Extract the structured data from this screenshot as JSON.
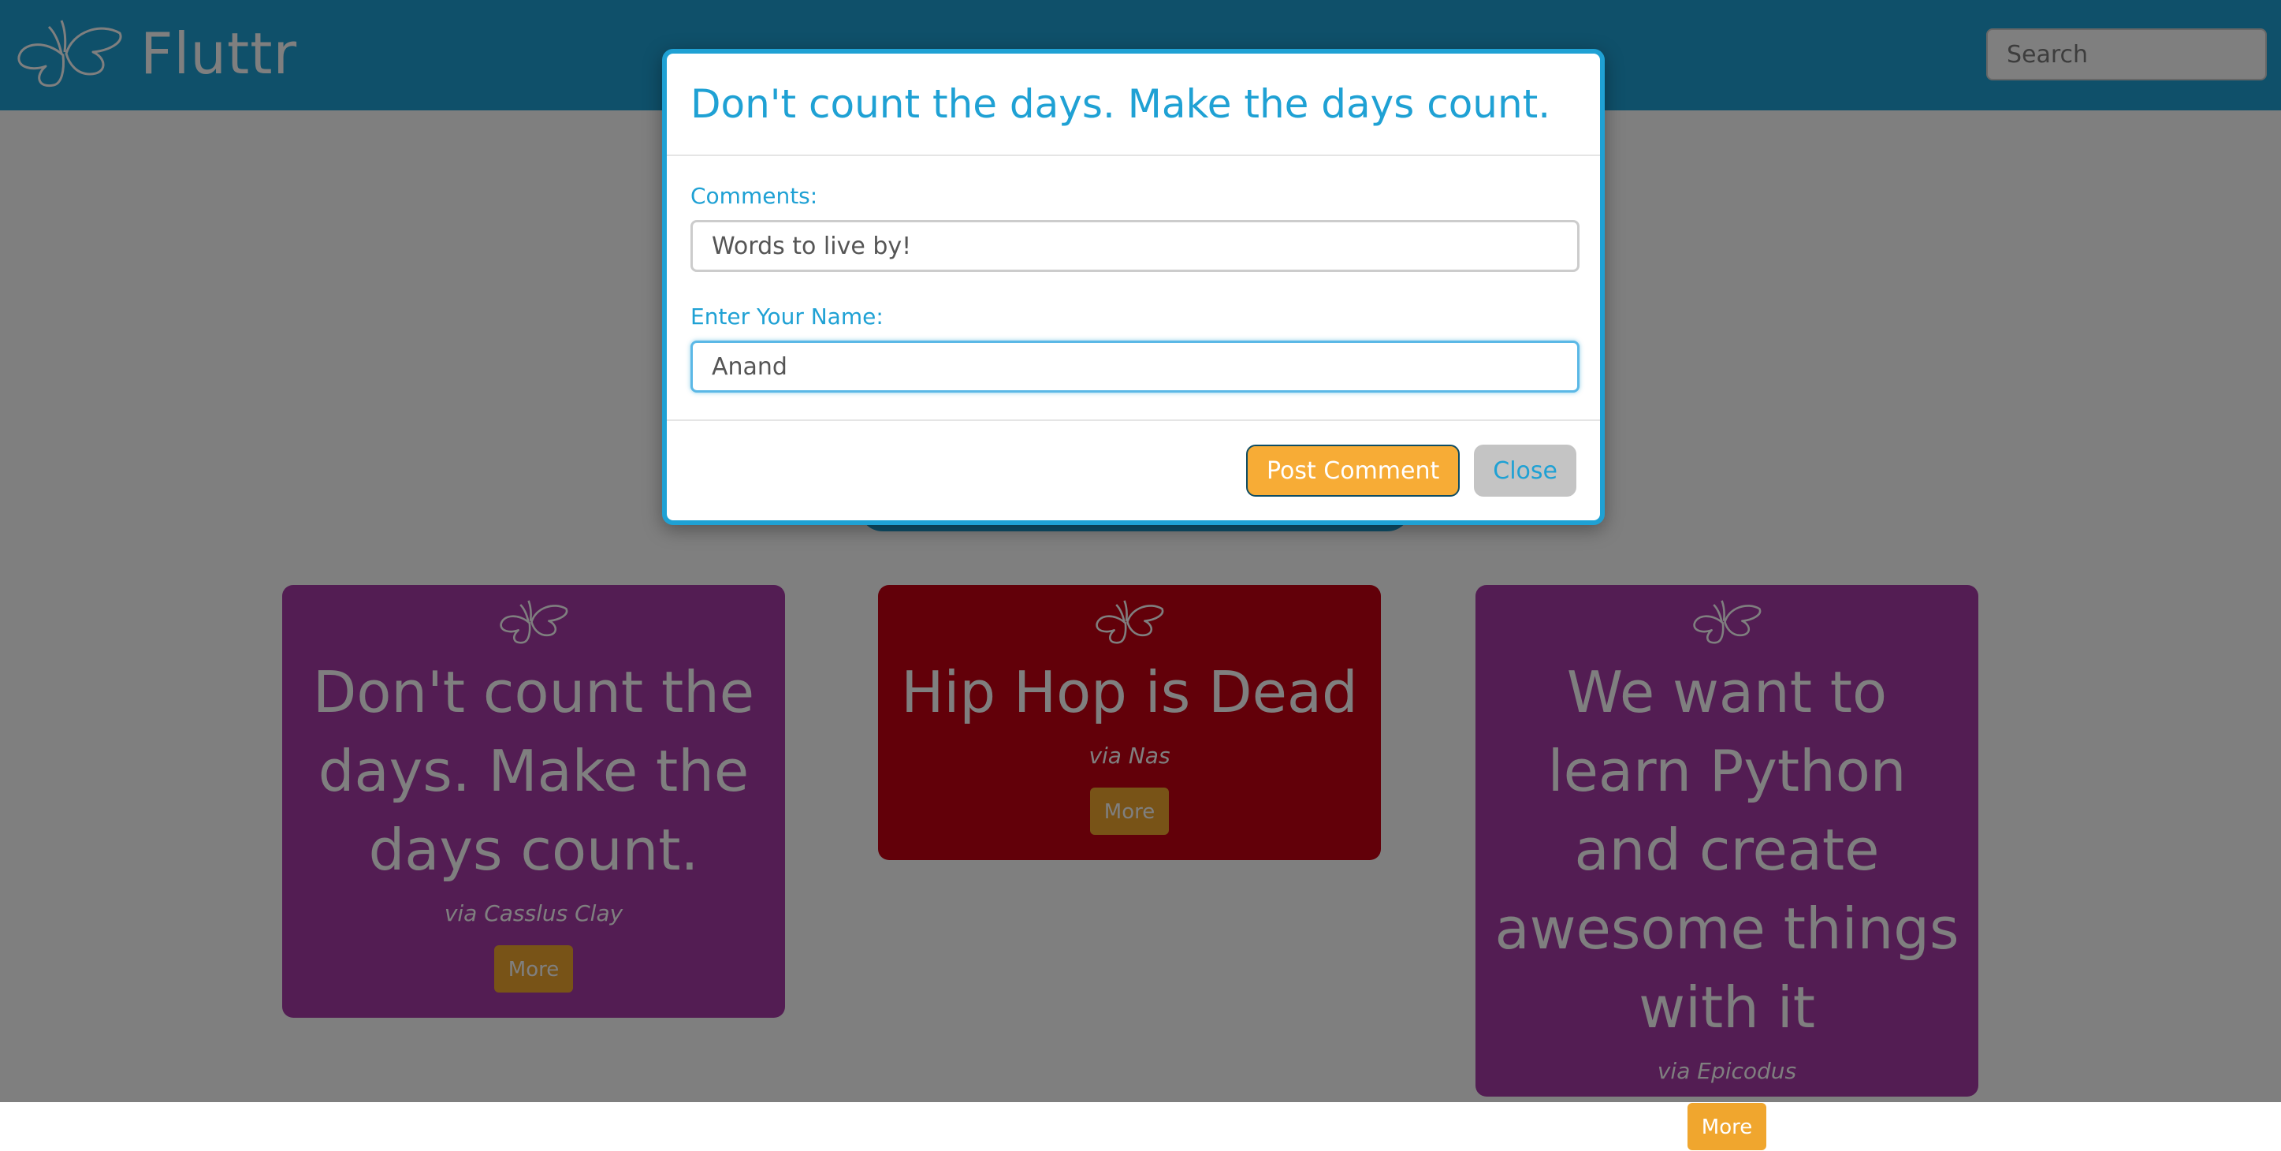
{
  "navbar": {
    "brand_name": "Fluttr",
    "logo_icon": "butterfly-icon",
    "search_placeholder": "Search",
    "background_color": "#1fa1d4"
  },
  "cards": [
    {
      "quote": "Don't count the days. Make the days count.",
      "via": "via Casslus Clay",
      "button_label": "More",
      "color": "#a63aa6"
    },
    {
      "quote": "Hip Hop is Dead",
      "via": "via Nas",
      "button_label": "More",
      "color": "#c40012"
    },
    {
      "quote": "We want to learn Python and create awesome things with it",
      "via": "via Epicodus",
      "button_label": "More",
      "color": "#a63aa6"
    }
  ],
  "modal": {
    "title": "Don't count the days. Make the days count.",
    "comments_label": "Comments:",
    "comments_value": "Words to live by!",
    "name_label": "Enter Your Name:",
    "name_value": "Anand ",
    "post_button": "Post Comment",
    "close_button": "Close",
    "accent_color": "#1fa1d4",
    "post_button_color": "#f7ac36"
  }
}
